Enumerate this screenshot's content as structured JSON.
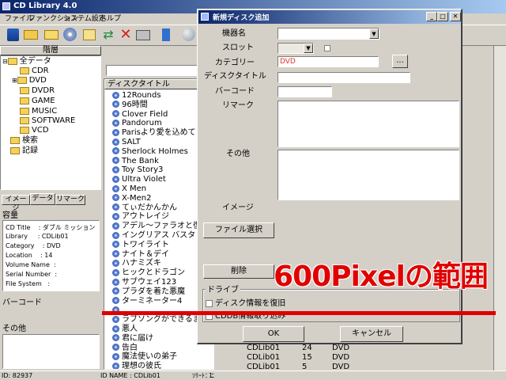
{
  "main_window": {
    "title": "CD Library 4.0",
    "menu": [
      "ファイル",
      "ファンクション",
      "システム設定",
      "ヘルプ"
    ]
  },
  "tree": {
    "header": "階層",
    "items": [
      {
        "label": "全データ",
        "level": 0
      },
      {
        "label": "CDR",
        "level": 1
      },
      {
        "label": "DVD",
        "level": 1
      },
      {
        "label": "DVDR",
        "level": 1
      },
      {
        "label": "GAME",
        "level": 1
      },
      {
        "label": "MUSIC",
        "level": 1
      },
      {
        "label": "SOFTWARE",
        "level": 1
      },
      {
        "label": "VCD",
        "level": 1
      },
      {
        "label": "検索",
        "level": 0
      },
      {
        "label": "記録",
        "level": 0
      }
    ]
  },
  "left_tabs": [
    "イメージ",
    "データ",
    "リマーク"
  ],
  "capacity_label": "容量",
  "info_lines": [
    "CD Title    : ダブル ミッション",
    "Library     : CDLib01",
    "Category    : DVD",
    "Location    : 14",
    "Volume Name  :",
    "Serial Number  :",
    "File System   :"
  ],
  "barcode_label": "バーコード",
  "other_label": "その他",
  "list": {
    "column_title": "ディスクタイトル",
    "titles": [
      "12Rounds",
      "96時間",
      "Clover Field",
      "Pandorum",
      "Parisより愛を込めて",
      "SALT",
      "Sherlock Holmes",
      "The Bank",
      "Toy Story3",
      "Ultra Violet",
      "X Men",
      "X-Men2",
      "てぃだかんかん",
      "アウトレイジ",
      "アデル～ファラオと復",
      "イングリアス バスタ",
      "トワイライト",
      "ナイト＆デイ",
      "ハナミズキ",
      "ヒックとドラゴン",
      "サブウェイ123",
      "プラダを着た悪魔",
      "ターミネーター4",
      "",
      "ラブソングができるま",
      "悪人",
      "君に届け",
      "告白",
      "魔法使いの弟子",
      "理想の彼氏"
    ],
    "extra_rows": [
      {
        "lib": "CDLib01",
        "num": "24",
        "cat": "DVD"
      },
      {
        "lib": "CDLib01",
        "num": "15",
        "cat": "DVD"
      },
      {
        "lib": "CDLib01",
        "num": "5",
        "cat": "DVD"
      }
    ]
  },
  "statusbar": {
    "left": "ID: 82937",
    "mid": "ID NAME : CDLib01",
    "mid2": "ｿﾘｰﾄ：ﾆ",
    "right": "1"
  },
  "dialog": {
    "title": "新規ディスク追加",
    "labels": {
      "device": "機器名",
      "slot": "スロット",
      "category": "カテゴリー",
      "disc_title": "ディスクタイトル",
      "barcode": "バーコード",
      "remark": "リマーク",
      "other": "その他",
      "image": "イメージ"
    },
    "category_value": "DVD",
    "browse_btn": "...",
    "file_select_btn": "ファイル選択",
    "delete_btn": "削除",
    "drive_group": "ドライブ",
    "checkbox_disc_info": "ディスク情報を復旧",
    "checkbox_cddb": "CDDB情報取り込み",
    "ok_btn": "OK",
    "cancel_btn": "キャンセル"
  },
  "annotation": {
    "text": "600Pixelの範囲",
    "color": "#e00000"
  }
}
